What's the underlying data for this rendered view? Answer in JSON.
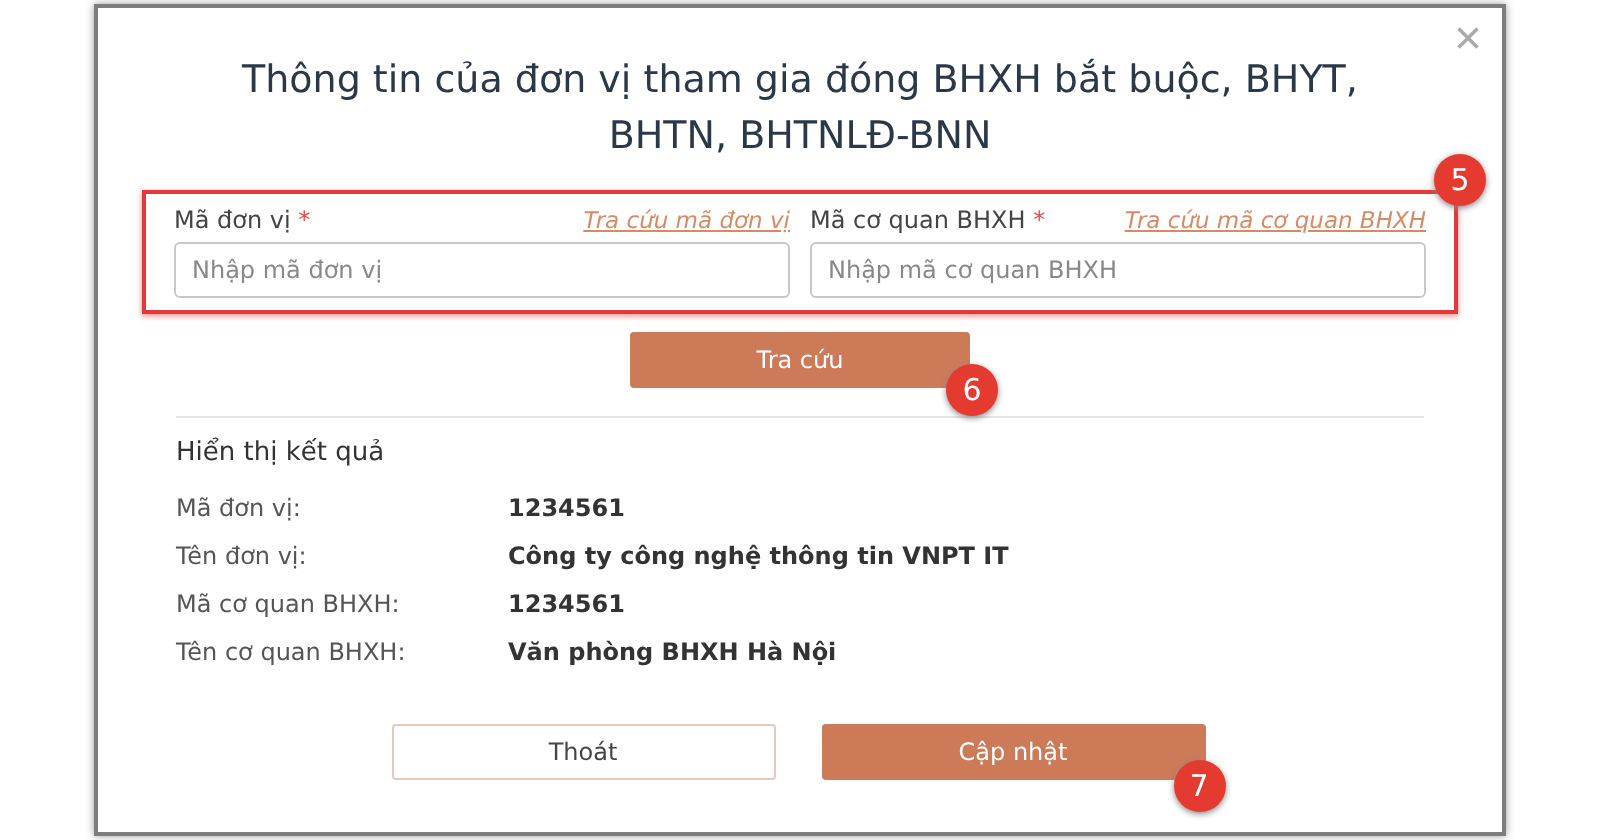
{
  "dialog": {
    "title": "Thông tin của đơn vị tham gia đóng BHXH bắt buộc, BHYT, BHTN, BHTNLĐ-BNN",
    "close": "×"
  },
  "search_form": {
    "badge": "5",
    "fields": [
      {
        "label": "Mã đơn vị",
        "required_mark": "*",
        "link": "Tra cứu mã đơn vị",
        "placeholder": "Nhập mã đơn vị"
      },
      {
        "label": "Mã cơ quan BHXH",
        "required_mark": "*",
        "link": "Tra cứu mã cơ quan BHXH",
        "placeholder": "Nhập mã cơ quan BHXH"
      }
    ]
  },
  "search_button": {
    "label": "Tra cứu",
    "badge": "6"
  },
  "results": {
    "heading": "Hiển thị kết quả",
    "rows": [
      {
        "label": "Mã đơn vị:",
        "value": "1234561"
      },
      {
        "label": "Tên đơn vị:",
        "value": "Công ty công nghệ thông tin VNPT IT"
      },
      {
        "label": "Mã cơ quan BHXH:",
        "value": "1234561"
      },
      {
        "label": "Tên cơ quan BHXH:",
        "value": "Văn phòng BHXH Hà Nội"
      }
    ]
  },
  "buttons": [
    {
      "label": "Thoát",
      "kind": "outline"
    },
    {
      "label": "Cập nhật",
      "kind": "primary",
      "badge": "7"
    }
  ]
}
